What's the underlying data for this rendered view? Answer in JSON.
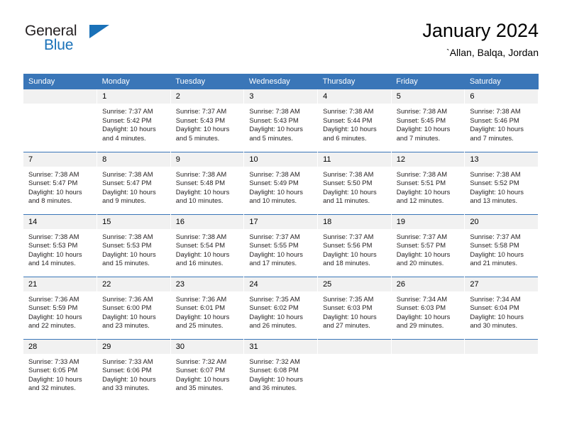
{
  "brand": {
    "name_part1": "General",
    "name_part2": "Blue",
    "triangle_color": "#1a71b8",
    "text_color": "#231f20"
  },
  "header": {
    "title": "January 2024",
    "subtitle": "`Allan, Balqa, Jordan"
  },
  "theme": {
    "header_blue": "#3a76b8",
    "daynum_gray": "#f1f1f1",
    "cell_white": "#ffffff",
    "text_black": "#231f20"
  },
  "weekdays": [
    "Sunday",
    "Monday",
    "Tuesday",
    "Wednesday",
    "Thursday",
    "Friday",
    "Saturday"
  ],
  "labels": {
    "sunrise_prefix": "Sunrise:",
    "sunset_prefix": "Sunset:",
    "daylight_prefix": "Daylight:"
  },
  "weeks": [
    [
      {
        "day": "",
        "empty": true,
        "line1": "",
        "line2": "",
        "line3": "",
        "line4": ""
      },
      {
        "day": "1",
        "line1": "Sunrise: 7:37 AM",
        "line2": "Sunset: 5:42 PM",
        "line3": "Daylight: 10 hours",
        "line4": "and 4 minutes."
      },
      {
        "day": "2",
        "line1": "Sunrise: 7:37 AM",
        "line2": "Sunset: 5:43 PM",
        "line3": "Daylight: 10 hours",
        "line4": "and 5 minutes."
      },
      {
        "day": "3",
        "line1": "Sunrise: 7:38 AM",
        "line2": "Sunset: 5:43 PM",
        "line3": "Daylight: 10 hours",
        "line4": "and 5 minutes."
      },
      {
        "day": "4",
        "line1": "Sunrise: 7:38 AM",
        "line2": "Sunset: 5:44 PM",
        "line3": "Daylight: 10 hours",
        "line4": "and 6 minutes."
      },
      {
        "day": "5",
        "line1": "Sunrise: 7:38 AM",
        "line2": "Sunset: 5:45 PM",
        "line3": "Daylight: 10 hours",
        "line4": "and 7 minutes."
      },
      {
        "day": "6",
        "line1": "Sunrise: 7:38 AM",
        "line2": "Sunset: 5:46 PM",
        "line3": "Daylight: 10 hours",
        "line4": "and 7 minutes."
      }
    ],
    [
      {
        "day": "7",
        "line1": "Sunrise: 7:38 AM",
        "line2": "Sunset: 5:47 PM",
        "line3": "Daylight: 10 hours",
        "line4": "and 8 minutes."
      },
      {
        "day": "8",
        "line1": "Sunrise: 7:38 AM",
        "line2": "Sunset: 5:47 PM",
        "line3": "Daylight: 10 hours",
        "line4": "and 9 minutes."
      },
      {
        "day": "9",
        "line1": "Sunrise: 7:38 AM",
        "line2": "Sunset: 5:48 PM",
        "line3": "Daylight: 10 hours",
        "line4": "and 10 minutes."
      },
      {
        "day": "10",
        "line1": "Sunrise: 7:38 AM",
        "line2": "Sunset: 5:49 PM",
        "line3": "Daylight: 10 hours",
        "line4": "and 10 minutes."
      },
      {
        "day": "11",
        "line1": "Sunrise: 7:38 AM",
        "line2": "Sunset: 5:50 PM",
        "line3": "Daylight: 10 hours",
        "line4": "and 11 minutes."
      },
      {
        "day": "12",
        "line1": "Sunrise: 7:38 AM",
        "line2": "Sunset: 5:51 PM",
        "line3": "Daylight: 10 hours",
        "line4": "and 12 minutes."
      },
      {
        "day": "13",
        "line1": "Sunrise: 7:38 AM",
        "line2": "Sunset: 5:52 PM",
        "line3": "Daylight: 10 hours",
        "line4": "and 13 minutes."
      }
    ],
    [
      {
        "day": "14",
        "line1": "Sunrise: 7:38 AM",
        "line2": "Sunset: 5:53 PM",
        "line3": "Daylight: 10 hours",
        "line4": "and 14 minutes."
      },
      {
        "day": "15",
        "line1": "Sunrise: 7:38 AM",
        "line2": "Sunset: 5:53 PM",
        "line3": "Daylight: 10 hours",
        "line4": "and 15 minutes."
      },
      {
        "day": "16",
        "line1": "Sunrise: 7:38 AM",
        "line2": "Sunset: 5:54 PM",
        "line3": "Daylight: 10 hours",
        "line4": "and 16 minutes."
      },
      {
        "day": "17",
        "line1": "Sunrise: 7:37 AM",
        "line2": "Sunset: 5:55 PM",
        "line3": "Daylight: 10 hours",
        "line4": "and 17 minutes."
      },
      {
        "day": "18",
        "line1": "Sunrise: 7:37 AM",
        "line2": "Sunset: 5:56 PM",
        "line3": "Daylight: 10 hours",
        "line4": "and 18 minutes."
      },
      {
        "day": "19",
        "line1": "Sunrise: 7:37 AM",
        "line2": "Sunset: 5:57 PM",
        "line3": "Daylight: 10 hours",
        "line4": "and 20 minutes."
      },
      {
        "day": "20",
        "line1": "Sunrise: 7:37 AM",
        "line2": "Sunset: 5:58 PM",
        "line3": "Daylight: 10 hours",
        "line4": "and 21 minutes."
      }
    ],
    [
      {
        "day": "21",
        "line1": "Sunrise: 7:36 AM",
        "line2": "Sunset: 5:59 PM",
        "line3": "Daylight: 10 hours",
        "line4": "and 22 minutes."
      },
      {
        "day": "22",
        "line1": "Sunrise: 7:36 AM",
        "line2": "Sunset: 6:00 PM",
        "line3": "Daylight: 10 hours",
        "line4": "and 23 minutes."
      },
      {
        "day": "23",
        "line1": "Sunrise: 7:36 AM",
        "line2": "Sunset: 6:01 PM",
        "line3": "Daylight: 10 hours",
        "line4": "and 25 minutes."
      },
      {
        "day": "24",
        "line1": "Sunrise: 7:35 AM",
        "line2": "Sunset: 6:02 PM",
        "line3": "Daylight: 10 hours",
        "line4": "and 26 minutes."
      },
      {
        "day": "25",
        "line1": "Sunrise: 7:35 AM",
        "line2": "Sunset: 6:03 PM",
        "line3": "Daylight: 10 hours",
        "line4": "and 27 minutes."
      },
      {
        "day": "26",
        "line1": "Sunrise: 7:34 AM",
        "line2": "Sunset: 6:03 PM",
        "line3": "Daylight: 10 hours",
        "line4": "and 29 minutes."
      },
      {
        "day": "27",
        "line1": "Sunrise: 7:34 AM",
        "line2": "Sunset: 6:04 PM",
        "line3": "Daylight: 10 hours",
        "line4": "and 30 minutes."
      }
    ],
    [
      {
        "day": "28",
        "line1": "Sunrise: 7:33 AM",
        "line2": "Sunset: 6:05 PM",
        "line3": "Daylight: 10 hours",
        "line4": "and 32 minutes."
      },
      {
        "day": "29",
        "line1": "Sunrise: 7:33 AM",
        "line2": "Sunset: 6:06 PM",
        "line3": "Daylight: 10 hours",
        "line4": "and 33 minutes."
      },
      {
        "day": "30",
        "line1": "Sunrise: 7:32 AM",
        "line2": "Sunset: 6:07 PM",
        "line3": "Daylight: 10 hours",
        "line4": "and 35 minutes."
      },
      {
        "day": "31",
        "line1": "Sunrise: 7:32 AM",
        "line2": "Sunset: 6:08 PM",
        "line3": "Daylight: 10 hours",
        "line4": "and 36 minutes."
      },
      {
        "day": "",
        "empty": true,
        "line1": "",
        "line2": "",
        "line3": "",
        "line4": ""
      },
      {
        "day": "",
        "empty": true,
        "line1": "",
        "line2": "",
        "line3": "",
        "line4": ""
      },
      {
        "day": "",
        "empty": true,
        "line1": "",
        "line2": "",
        "line3": "",
        "line4": ""
      }
    ]
  ]
}
